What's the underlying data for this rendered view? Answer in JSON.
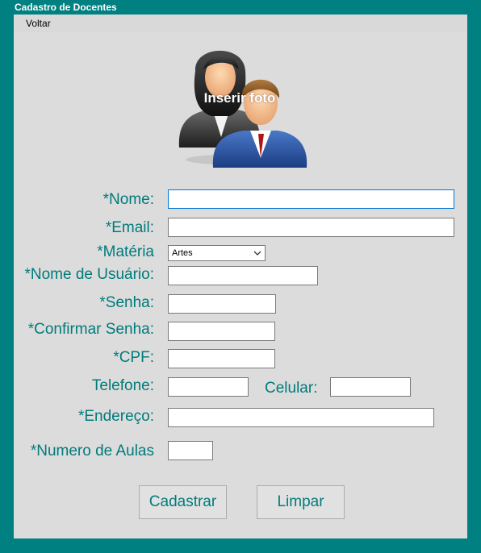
{
  "window": {
    "title": "Cadastro de Docentes"
  },
  "menu": {
    "back_label": "Voltar"
  },
  "photo": {
    "label": "Inserir foto",
    "icon": "users-icon"
  },
  "form": {
    "nome_label": "*Nome:",
    "email_label": "*Email:",
    "materia_label": "*Matéria",
    "materia_value": "Artes",
    "usuario_label": "*Nome de Usuário:",
    "senha_label": "*Senha:",
    "confirmar_label": "*Confirmar Senha:",
    "cpf_label": "*CPF:",
    "telefone_label": "Telefone:",
    "celular_label": "Celular:",
    "endereco_label": "*Endereço:",
    "aulas_label": "*Numero de Aulas"
  },
  "buttons": {
    "cadastrar_label": "Cadastrar",
    "limpar_label": "Limpar"
  },
  "colors": {
    "frame": "#008080",
    "label": "#007b7b",
    "panel": "#dcdcdc"
  }
}
